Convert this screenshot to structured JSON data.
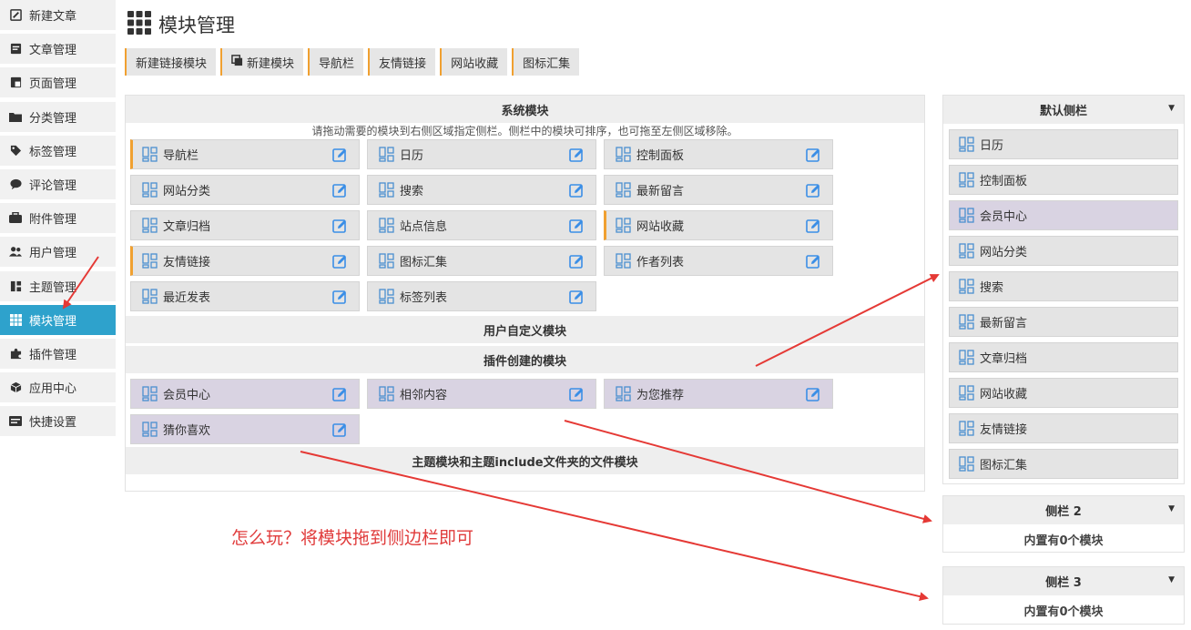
{
  "sidebar": {
    "groups": [
      [
        {
          "label": "新建文章",
          "icon": "edit-icon"
        },
        {
          "label": "文章管理",
          "icon": "file-icon"
        },
        {
          "label": "页面管理",
          "icon": "page-icon"
        }
      ],
      [
        {
          "label": "分类管理",
          "icon": "folder-icon"
        },
        {
          "label": "标签管理",
          "icon": "tag-icon"
        },
        {
          "label": "评论管理",
          "icon": "comment-icon"
        },
        {
          "label": "附件管理",
          "icon": "attachment-icon"
        },
        {
          "label": "用户管理",
          "icon": "users-icon"
        }
      ],
      [
        {
          "label": "主题管理",
          "icon": "theme-icon"
        },
        {
          "label": "模块管理",
          "icon": "grid-icon",
          "active": true
        },
        {
          "label": "插件管理",
          "icon": "puzzle-icon"
        },
        {
          "label": "应用中心",
          "icon": "box-icon"
        },
        {
          "label": "快捷设置",
          "icon": "settings-icon"
        }
      ]
    ]
  },
  "header": {
    "title": "模块管理",
    "icon": "grid-icon"
  },
  "toolbar": {
    "buttons": [
      {
        "label": "新建链接模块"
      },
      {
        "label": "新建模块",
        "icon": "copy-icon"
      },
      {
        "label": "导航栏"
      },
      {
        "label": "友情链接"
      },
      {
        "label": "网站收藏"
      },
      {
        "label": "图标汇集"
      }
    ]
  },
  "system": {
    "title": "系统模块",
    "hint": "请拖动需要的模块到右侧区域指定侧栏。侧栏中的模块可排序，也可拖至左侧区域移除。",
    "modules": [
      {
        "label": "导航栏",
        "highlight": true
      },
      {
        "label": "日历"
      },
      {
        "label": "控制面板"
      },
      {
        "label": "网站分类"
      },
      {
        "label": "搜索"
      },
      {
        "label": "最新留言"
      },
      {
        "label": "文章归档"
      },
      {
        "label": "站点信息"
      },
      {
        "label": "网站收藏",
        "highlight": true
      },
      {
        "label": "友情链接",
        "highlight": true
      },
      {
        "label": "图标汇集"
      },
      {
        "label": "作者列表"
      },
      {
        "label": "最近发表"
      },
      {
        "label": "标签列表"
      }
    ]
  },
  "user_defined": {
    "title": "用户自定义模块"
  },
  "plugin": {
    "title": "插件创建的模块",
    "modules": [
      {
        "label": "会员中心"
      },
      {
        "label": "相邻内容"
      },
      {
        "label": "为您推荐"
      },
      {
        "label": "猜你喜欢"
      }
    ]
  },
  "theme_modules": {
    "title": "主题模块和主题include文件夹的文件模块"
  },
  "sidebars": [
    {
      "title": "默认侧栏",
      "items": [
        {
          "label": "日历"
        },
        {
          "label": "控制面板"
        },
        {
          "label": "会员中心",
          "plugin": true
        },
        {
          "label": "网站分类"
        },
        {
          "label": "搜索"
        },
        {
          "label": "最新留言"
        },
        {
          "label": "文章归档"
        },
        {
          "label": "网站收藏"
        },
        {
          "label": "友情链接"
        },
        {
          "label": "图标汇集"
        }
      ]
    },
    {
      "title": "侧栏 2",
      "empty": "内置有0个模块"
    },
    {
      "title": "侧栏 3",
      "empty": "内置有0个模块"
    }
  ],
  "annotation": {
    "text": "怎么玩？将模块拖到侧边栏即可",
    "color": "#e03b3b"
  },
  "colors": {
    "accent": "#2ea2cc",
    "highlight_border": "#f0a030",
    "plugin_bg": "#d9d3e2",
    "module_bg": "#e4e4e4"
  }
}
